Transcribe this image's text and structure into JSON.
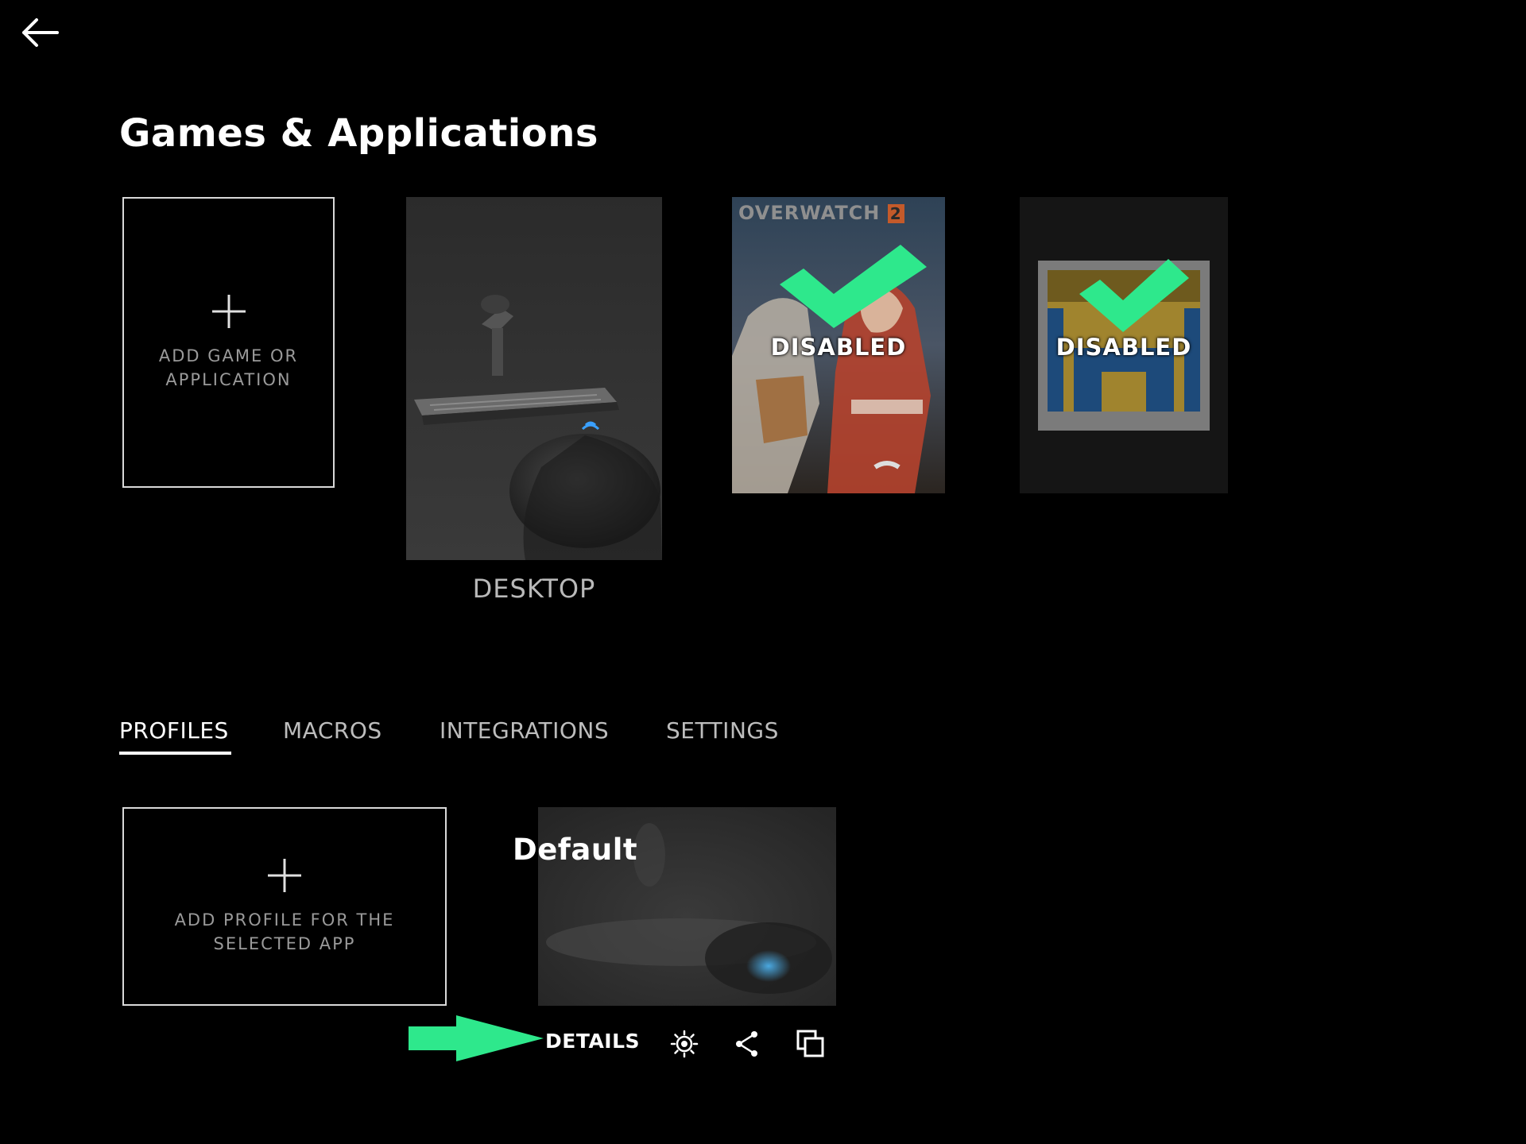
{
  "header": {
    "back_icon": "arrow-left-icon",
    "title": "Games & Applications"
  },
  "apps": {
    "add_card": {
      "line1": "ADD GAME OR",
      "line2": "APPLICATION",
      "icon": "plus-icon"
    },
    "items": [
      {
        "label": "DESKTOP",
        "status": ""
      },
      {
        "logo_text": "OVERWATCH",
        "logo_num": "2",
        "status": "DISABLED"
      },
      {
        "status": "DISABLED"
      }
    ],
    "accent_color": "#2ee88c"
  },
  "tabs": [
    {
      "label": "PROFILES",
      "active": true
    },
    {
      "label": "MACROS",
      "active": false
    },
    {
      "label": "INTEGRATIONS",
      "active": false
    },
    {
      "label": "SETTINGS",
      "active": false
    }
  ],
  "profiles": {
    "add_card": {
      "line1": "ADD PROFILE FOR THE",
      "line2": "SELECTED APP",
      "icon": "plus-icon"
    },
    "items": [
      {
        "name": "Default"
      }
    ],
    "actions": {
      "details_label": "DETAILS",
      "icons": [
        "lighting-icon",
        "share-icon",
        "duplicate-icon"
      ]
    },
    "pointer_arrow_icon": "arrow-right-icon"
  }
}
